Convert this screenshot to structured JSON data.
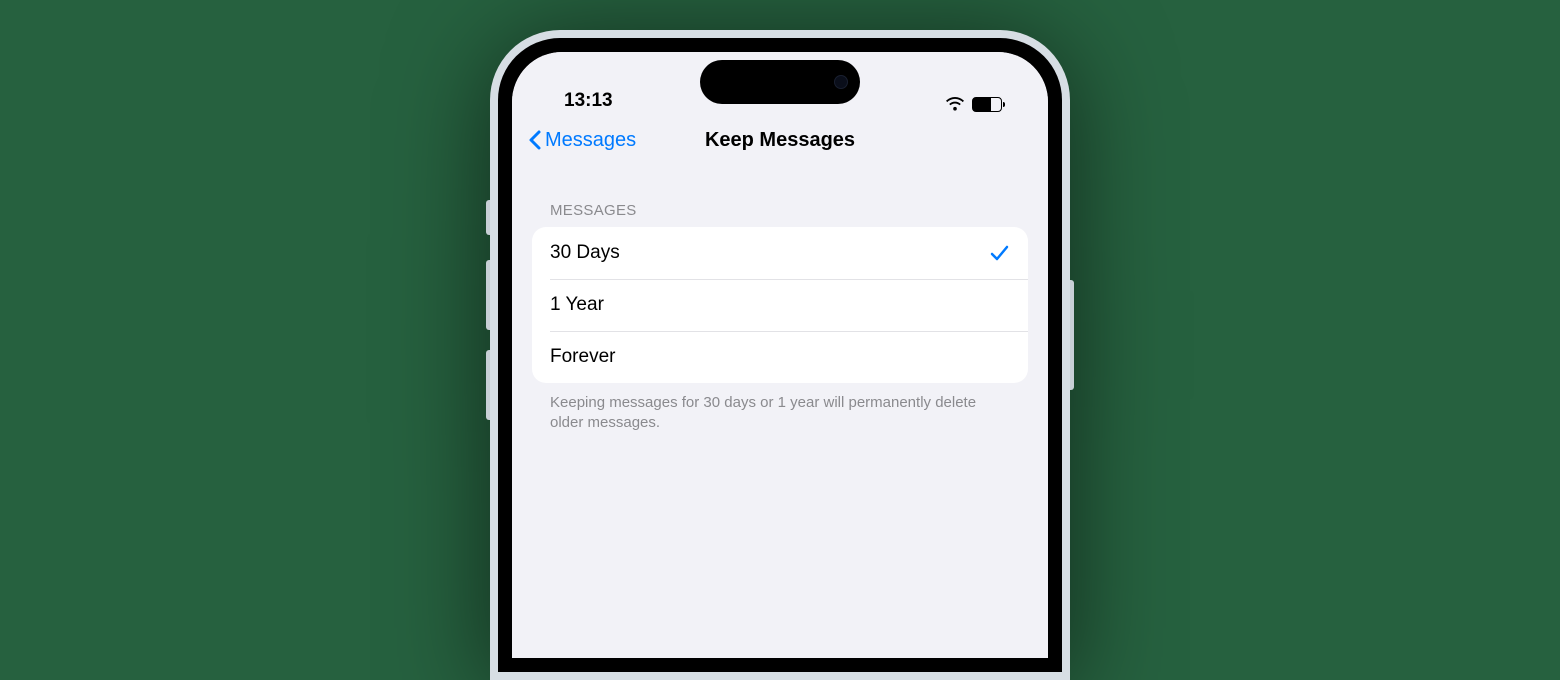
{
  "statusBar": {
    "time": "13:13"
  },
  "nav": {
    "backLabel": "Messages",
    "title": "Keep Messages"
  },
  "section": {
    "header": "MESSAGES",
    "footer": "Keeping messages for 30 days or 1 year will permanently delete older messages.",
    "options": [
      {
        "label": "30 Days",
        "selected": true
      },
      {
        "label": "1 Year",
        "selected": false
      },
      {
        "label": "Forever",
        "selected": false
      }
    ]
  }
}
